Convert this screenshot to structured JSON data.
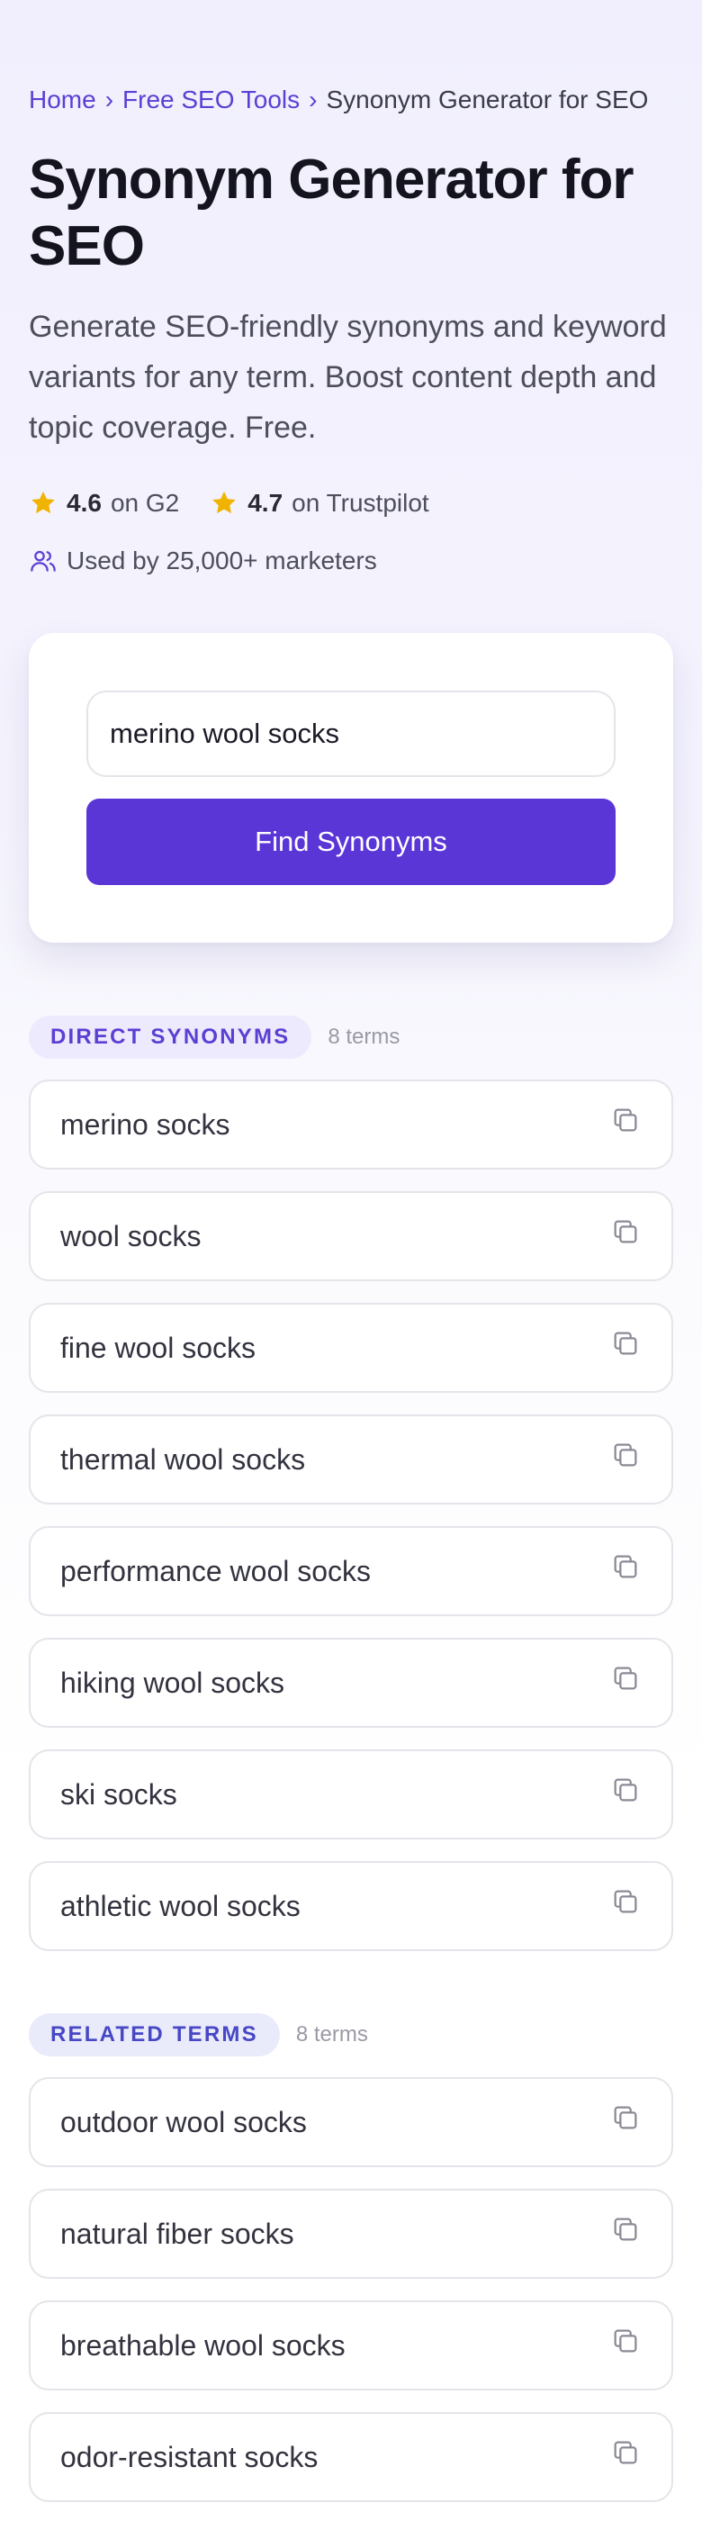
{
  "breadcrumb": {
    "items": [
      {
        "label": "Home"
      },
      {
        "label": "Free SEO Tools"
      },
      {
        "label": "Synonym Generator for SEO"
      }
    ],
    "separator": "›"
  },
  "header": {
    "title": "Synonym Generator for SEO",
    "subtitle": "Generate SEO-friendly synonyms and keyword variants for any term. Boost content depth and topic coverage. Free."
  },
  "ratings": [
    {
      "score": "4.6",
      "source": "on G2",
      "icon": "star-icon"
    },
    {
      "score": "4.7",
      "source": "on Trustpilot",
      "icon": "star-icon"
    }
  ],
  "social_proof": {
    "text": "Used by 25,000+ marketers",
    "icon": "users-icon"
  },
  "tool": {
    "input_value": "merino wool socks",
    "button_label": "Find Synonyms"
  },
  "sections": [
    {
      "label": "DIRECT SYNONYMS",
      "count": "8 terms",
      "terms": [
        "merino socks",
        "wool socks",
        "fine wool socks",
        "thermal wool socks",
        "performance wool socks",
        "hiking wool socks",
        "ski socks",
        "athletic wool socks"
      ]
    },
    {
      "label": "RELATED TERMS",
      "count": "8 terms",
      "terms": [
        "outdoor wool socks",
        "natural fiber socks",
        "breathable wool socks",
        "odor-resistant socks"
      ]
    }
  ],
  "colors": {
    "accent": "#5b36d7",
    "link": "#5b3fd3",
    "star": "#f0b400",
    "text": "#14141e"
  }
}
